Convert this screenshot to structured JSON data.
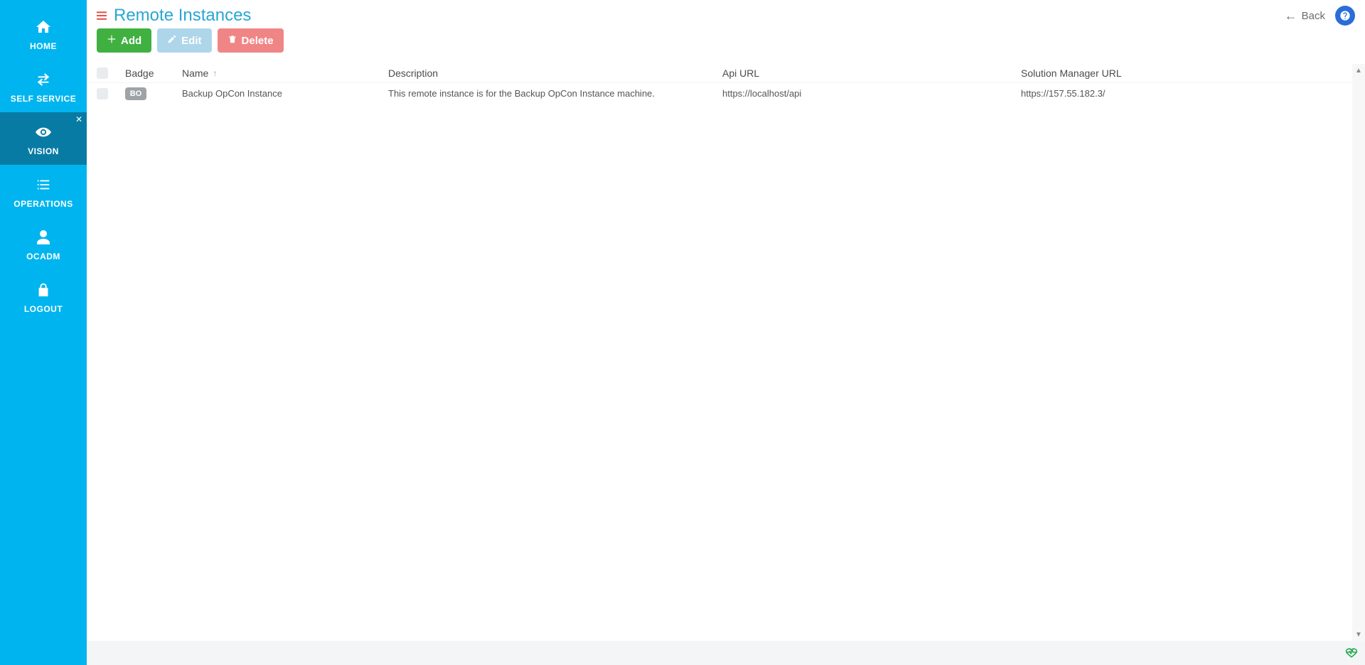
{
  "sidebar": {
    "items": [
      {
        "id": "home",
        "label": "HOME",
        "icon": "home"
      },
      {
        "id": "selfservice",
        "label": "SELF SERVICE",
        "icon": "exchange"
      },
      {
        "id": "vision",
        "label": "VISION",
        "icon": "eye",
        "active": true,
        "closable": true
      },
      {
        "id": "operations",
        "label": "OPERATIONS",
        "icon": "list"
      },
      {
        "id": "ocadm",
        "label": "OCADM",
        "icon": "user"
      },
      {
        "id": "logout",
        "label": "LOGOUT",
        "icon": "lock"
      }
    ]
  },
  "header": {
    "title": "Remote Instances",
    "back_label": "Back"
  },
  "toolbar": {
    "add_label": "Add",
    "edit_label": "Edit",
    "delete_label": "Delete"
  },
  "table": {
    "columns": {
      "badge": "Badge",
      "name": "Name",
      "description": "Description",
      "api_url": "Api URL",
      "sm_url": "Solution Manager URL"
    },
    "sort": {
      "column": "name",
      "direction": "asc"
    },
    "rows": [
      {
        "badge": "BO",
        "name": "Backup OpCon Instance",
        "description": "This remote instance is for the Backup OpCon Instance machine.",
        "api_url": "https://localhost/api",
        "sm_url": "https://157.55.182.3/"
      }
    ]
  }
}
